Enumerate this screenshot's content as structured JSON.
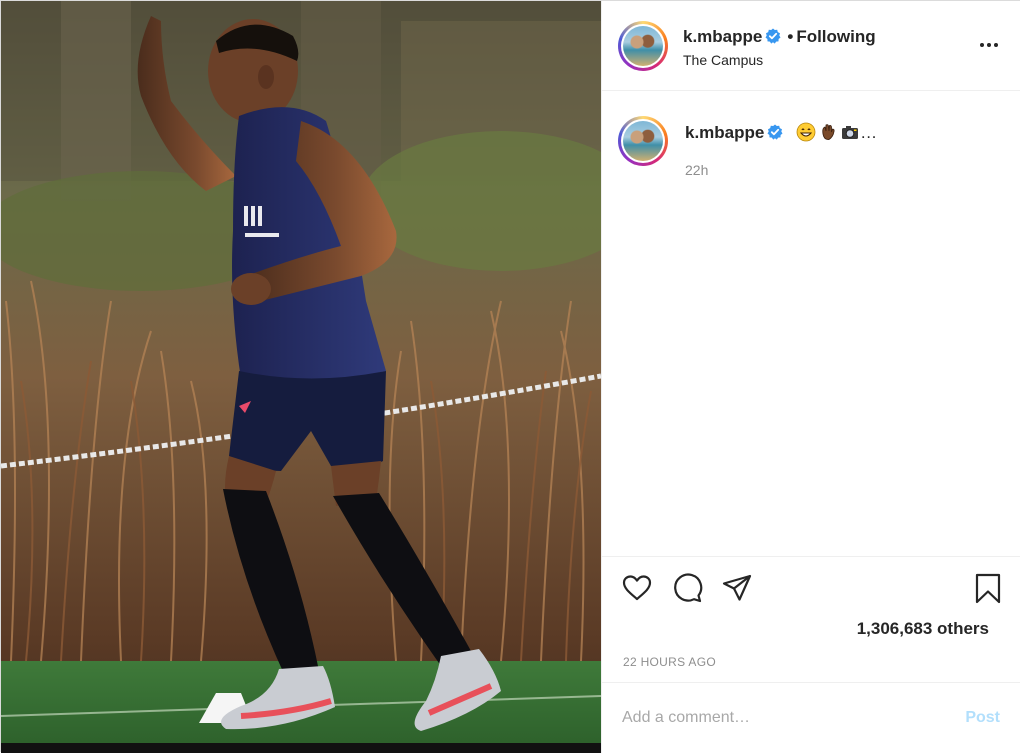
{
  "post": {
    "author": {
      "username": "k.mbappe",
      "verified": true,
      "follow_status": "Following",
      "separator": "•",
      "location": "The Campus"
    },
    "caption": {
      "username": "k.mbappe",
      "emojis": [
        "grinning-face-icon",
        "waving-hand-icon",
        "camera-icon"
      ],
      "ellipsis": "…",
      "time": "22h"
    },
    "likes_text": "1,306,683 others",
    "time_ago": "22 HOURS AGO",
    "comment": {
      "placeholder": "Add a comment…",
      "post_label": "Post"
    },
    "colors": {
      "verified_blue": "#3897f0",
      "post_button_disabled": "#b2dffc",
      "secondary_text": "#8e8e8e"
    }
  }
}
